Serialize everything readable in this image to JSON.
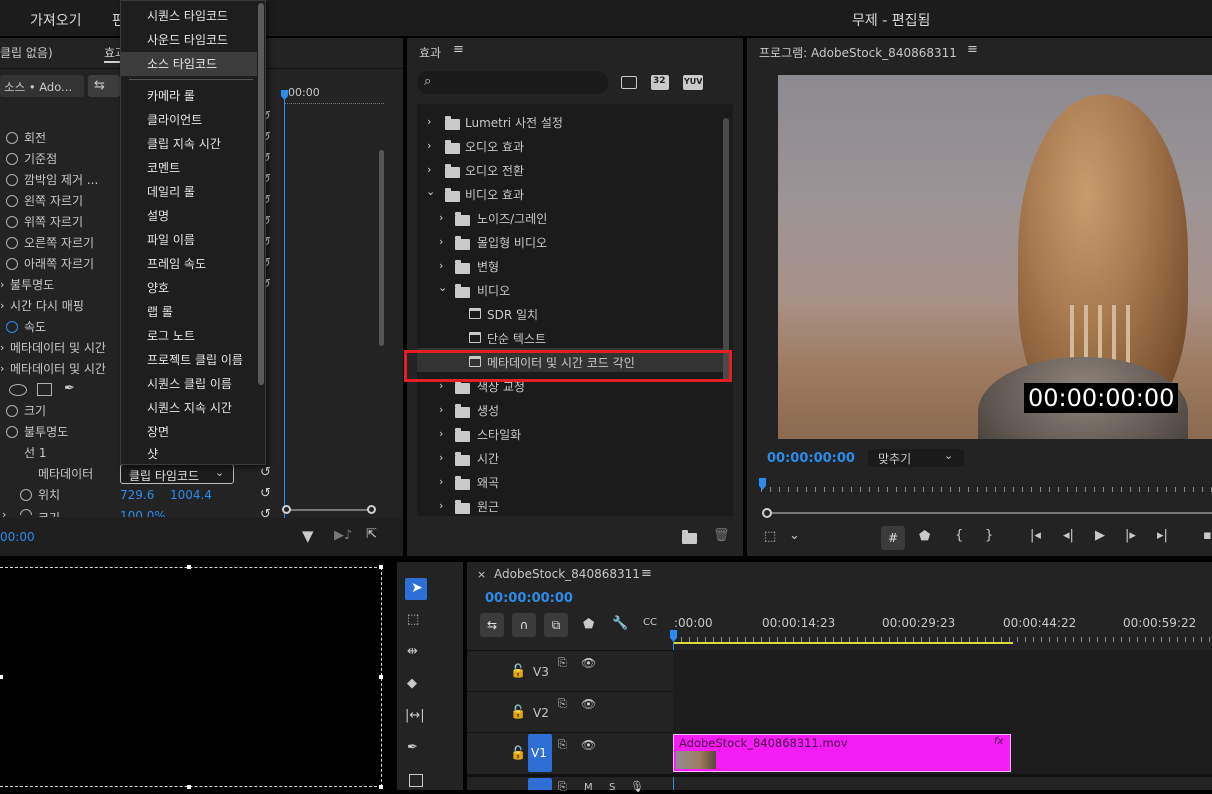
{
  "app": {
    "title": "무제 - 편집됨",
    "top_menu": [
      "가져오기",
      "편"
    ]
  },
  "effect_controls": {
    "tabs": [
      "클립 없음)",
      "효과"
    ],
    "source_chip": "소스 • Ado...",
    "ruler_time": "00:00",
    "rows": [
      {
        "label": "회전"
      },
      {
        "label": "기준점"
      },
      {
        "label": "깜박임 제거 ..."
      },
      {
        "label": "왼쪽 자르기"
      },
      {
        "label": "위쪽 자르기"
      },
      {
        "label": "오른쪽 자르기"
      },
      {
        "label": "아래쪽 자르기"
      },
      {
        "label": "불투명도"
      },
      {
        "label": "시간 다시 매핑"
      },
      {
        "label": "속도"
      },
      {
        "label": "메타데이터 및 시간"
      },
      {
        "label": "메타데이터 및 시간"
      },
      {
        "label": "크기"
      },
      {
        "label": "불투명도"
      },
      {
        "label": "선 1"
      },
      {
        "label": "메타데이터"
      },
      {
        "label": "위치"
      },
      {
        "label": "크기"
      }
    ],
    "metadata_dropdown": "클립 타임코드",
    "position_x": "729.6",
    "position_y": "1004.4",
    "scale_partial": "100.0%",
    "timecode": "00:00"
  },
  "context_menu": {
    "items": [
      "시퀀스 타임코드",
      "사운드 타임코드",
      "소스 타임코드",
      "카메라 롤",
      "클라이언트",
      "클립 지속 시간",
      "코멘트",
      "데일리 롤",
      "설명",
      "파일 이름",
      "프레임 속도",
      "양호",
      "랩 롤",
      "로그 노트",
      "프로젝트 클립 이름",
      "시퀀스 클립 이름",
      "시퀀스 지속 시간",
      "장면",
      "샷"
    ],
    "highlighted": "소스 타임코드"
  },
  "effects": {
    "title": "효과",
    "search_placeholder": "",
    "filter_badges": [
      "32",
      "YUV"
    ],
    "tree": [
      {
        "label": "Lumetri 사전 설정",
        "level": 0,
        "state": "collapsed"
      },
      {
        "label": "오디오 효과",
        "level": 0,
        "state": "collapsed"
      },
      {
        "label": "오디오 전환",
        "level": 0,
        "state": "collapsed"
      },
      {
        "label": "비디오 효과",
        "level": 0,
        "state": "expanded"
      },
      {
        "label": "노이즈/그레인",
        "level": 1,
        "state": "collapsed"
      },
      {
        "label": "몰입형 비디오",
        "level": 1,
        "state": "collapsed"
      },
      {
        "label": "변형",
        "level": 1,
        "state": "collapsed"
      },
      {
        "label": "비디오",
        "level": 1,
        "state": "expanded"
      },
      {
        "label": "SDR 일치",
        "level": 2,
        "state": "effect"
      },
      {
        "label": "단순 텍스트",
        "level": 2,
        "state": "effect"
      },
      {
        "label": "메타데이터 및 시간 코드 각인",
        "level": 2,
        "state": "effect-selected"
      },
      {
        "label": "색상 교정",
        "level": 1,
        "state": "collapsed"
      },
      {
        "label": "생성",
        "level": 1,
        "state": "collapsed"
      },
      {
        "label": "스타일화",
        "level": 1,
        "state": "collapsed"
      },
      {
        "label": "시간",
        "level": 1,
        "state": "collapsed"
      },
      {
        "label": "왜곡",
        "level": 1,
        "state": "collapsed"
      },
      {
        "label": "원근",
        "level": 1,
        "state": "collapsed"
      }
    ]
  },
  "program": {
    "title": "프로그램: AdobeStock_840868311",
    "overlay_timecode": "00:00:00:00",
    "timecode": "00:00:00:00",
    "fit_dropdown": "맞추기"
  },
  "timeline": {
    "sequence_tab": "AdobeStock_840868311",
    "timecode": "00:00:00:00",
    "ruler_labels": [
      ":00:00",
      "00:00:14:23",
      "00:00:29:23",
      "00:00:44:22",
      "00:00:59:22"
    ],
    "tracks": [
      "V3",
      "V2",
      "V1"
    ],
    "clip_name": "AdobeStock_840868311.mov",
    "clip_fx": "fx",
    "audio_partial": [
      "M",
      "S"
    ]
  },
  "colors": {
    "accent_blue": "#2d8ceb",
    "clip_magenta": "#f41df4",
    "highlight_red": "#e31e24",
    "panel_bg": "#232323",
    "work_area": "#d9d93b"
  }
}
